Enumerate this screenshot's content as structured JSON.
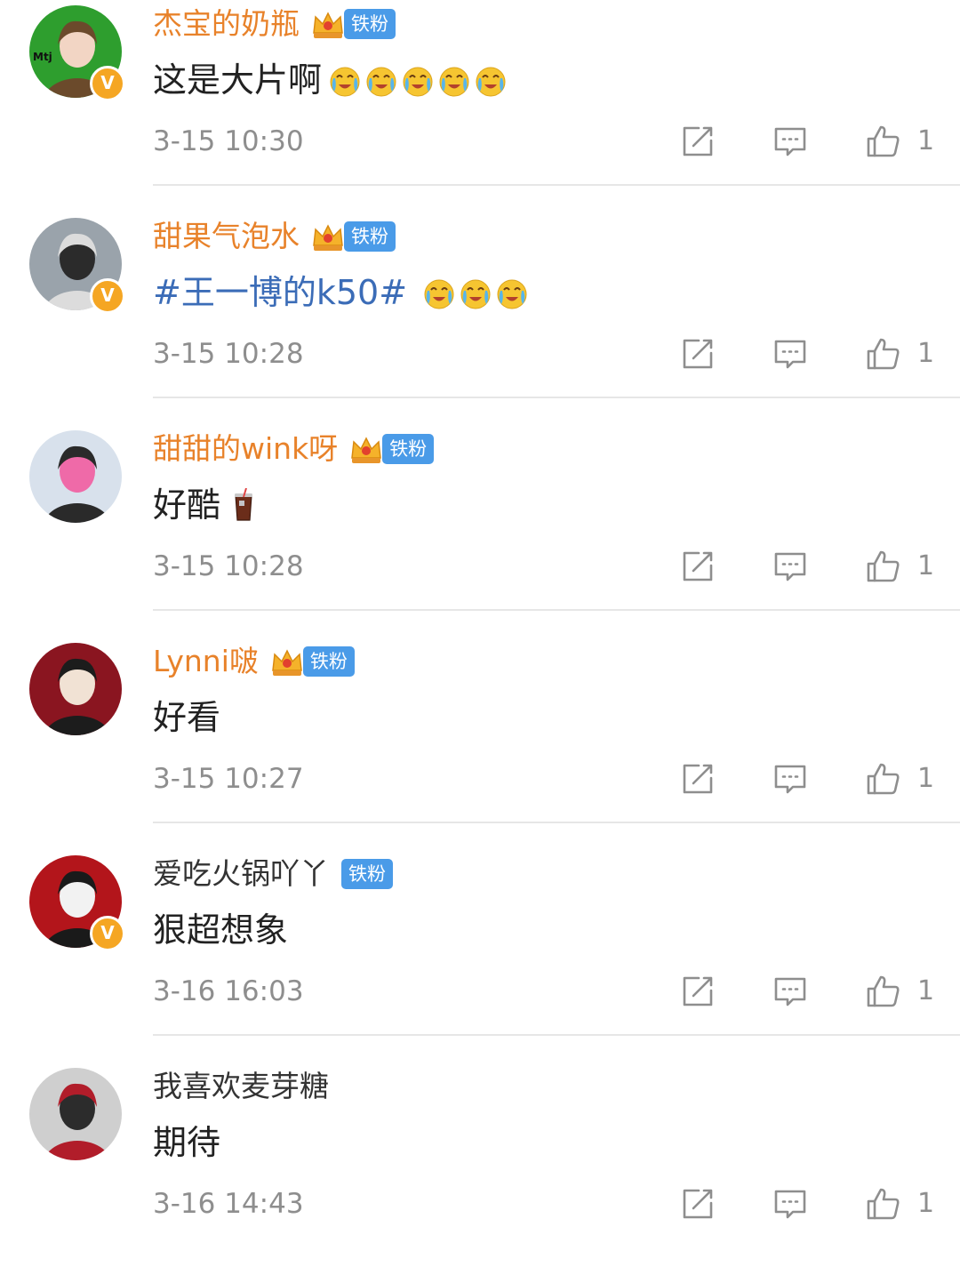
{
  "comments": [
    {
      "username": "杰宝的奶瓶",
      "name_color": "orange",
      "crown": true,
      "fan_badge": "铁粉",
      "verified": true,
      "verified_mark": "V",
      "avatar_art": "Mtj",
      "text": "这是大片啊",
      "topic": false,
      "emojis": [
        "crying-laughing-emoji",
        "crying-laughing-emoji",
        "crying-laughing-emoji",
        "crying-laughing-emoji",
        "crying-laughing-emoji"
      ],
      "time": "3-15 10:30",
      "likes": "1"
    },
    {
      "username": "甜果气泡水",
      "name_color": "orange",
      "crown": true,
      "fan_badge": "铁粉",
      "verified": true,
      "verified_mark": "V",
      "avatar_art": "",
      "text": "#王一博的k50#",
      "topic": true,
      "emojis": [
        "crying-emoji",
        "crying-emoji",
        "crying-emoji"
      ],
      "time": "3-15 10:28",
      "likes": "1"
    },
    {
      "username": "甜甜的wink呀",
      "name_color": "orange",
      "crown": true,
      "fan_badge": "铁粉",
      "verified": false,
      "verified_mark": "",
      "avatar_art": "",
      "text": "好酷",
      "topic": false,
      "emojis": [
        "cola-drink-emoji"
      ],
      "time": "3-15 10:28",
      "likes": "1"
    },
    {
      "username": "Lynni啵",
      "name_color": "orange",
      "crown": true,
      "fan_badge": "铁粉",
      "verified": false,
      "verified_mark": "",
      "avatar_art": "",
      "text": "好看",
      "topic": false,
      "emojis": [],
      "time": "3-15 10:27",
      "likes": "1"
    },
    {
      "username": "爱吃火锅吖丫",
      "name_color": "gray",
      "crown": false,
      "fan_badge": "铁粉",
      "verified": true,
      "verified_mark": "V",
      "avatar_art": "",
      "text": "狠超想象",
      "topic": false,
      "emojis": [],
      "time": "3-16 16:03",
      "likes": "1"
    },
    {
      "username": "我喜欢麦芽糖",
      "name_color": "gray",
      "crown": false,
      "fan_badge": "",
      "verified": false,
      "verified_mark": "",
      "avatar_art": "",
      "text": "期待",
      "topic": false,
      "emojis": [],
      "time": "3-16 14:43",
      "likes": "1"
    }
  ],
  "actions": [
    "share-icon",
    "reply-icon",
    "thumbs-up-icon"
  ],
  "colors": {
    "name_orange": "#e8822a",
    "name_gray": "#333333",
    "topic_blue": "#3b6cb7",
    "fan_badge_blue": "#4a9be8",
    "verified_gold": "#f5a623",
    "meta_gray": "#8e8e8e"
  }
}
